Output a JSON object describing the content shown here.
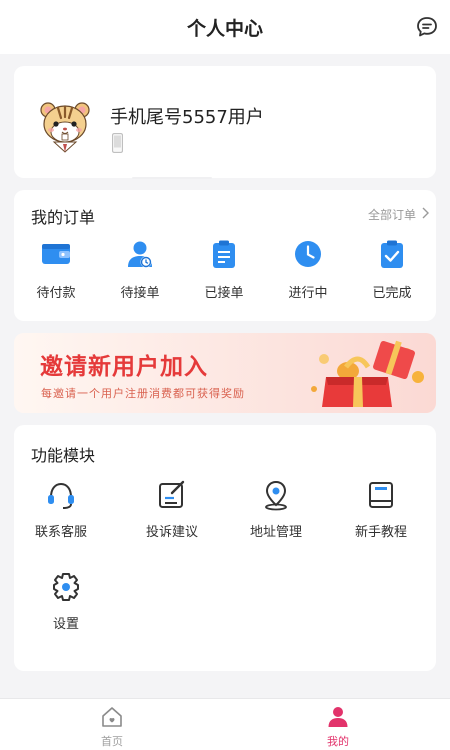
{
  "header": {
    "title": "个人中心",
    "message_icon": "chat-icon"
  },
  "profile": {
    "username": "手机尾号5557用户",
    "avatar_icon": "hamster-avatar",
    "phone_icon": "phone-icon"
  },
  "orders": {
    "title": "我的订单",
    "all_label": "全部订单",
    "items": [
      {
        "label": "待付款",
        "icon": "wallet-icon"
      },
      {
        "label": "待接单",
        "icon": "user-waiting-icon"
      },
      {
        "label": "已接单",
        "icon": "clipboard-icon"
      },
      {
        "label": "进行中",
        "icon": "clock-icon"
      },
      {
        "label": "已完成",
        "icon": "check-clipboard-icon"
      }
    ]
  },
  "banner": {
    "title": "邀请新用户加入",
    "subtitle": "每邀请一个用户注册消费都可获得奖励"
  },
  "functions": {
    "title": "功能模块",
    "items": [
      {
        "label": "联系客服",
        "icon": "headset-icon"
      },
      {
        "label": "投诉建议",
        "icon": "edit-icon"
      },
      {
        "label": "地址管理",
        "icon": "location-icon"
      },
      {
        "label": "新手教程",
        "icon": "book-icon"
      },
      {
        "label": "设置",
        "icon": "gear-icon"
      }
    ]
  },
  "tabbar": {
    "items": [
      {
        "label": "首页",
        "icon": "home-icon",
        "active": false
      },
      {
        "label": "我的",
        "icon": "person-icon",
        "active": true
      }
    ]
  },
  "colors": {
    "accent": "#e2336b",
    "order_icon_blue": "#2f8ef0",
    "banner_red": "#e53a3a"
  }
}
